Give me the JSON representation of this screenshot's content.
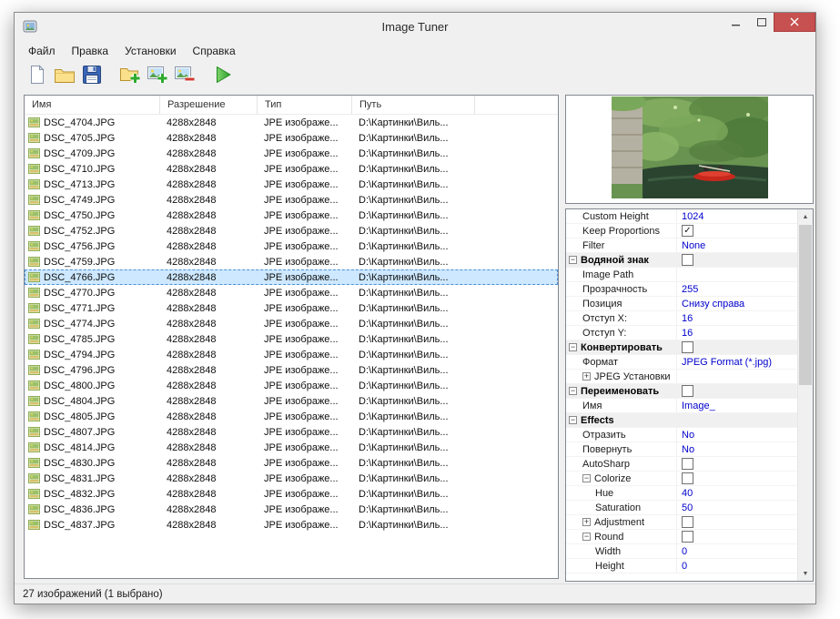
{
  "window": {
    "title": "Image Tuner"
  },
  "menu": {
    "items": [
      {
        "id": "file",
        "label": "Файл"
      },
      {
        "id": "edit",
        "label": "Правка"
      },
      {
        "id": "settings",
        "label": "Установки"
      },
      {
        "id": "help",
        "label": "Справка"
      }
    ]
  },
  "toolbar": {
    "icons": [
      "new-document-icon",
      "open-folder-icon",
      "save-icon",
      "add-folder-icon",
      "add-images-icon",
      "remove-images-icon",
      "run-icon"
    ]
  },
  "file_list": {
    "columns": [
      "Имя",
      "Разрешение",
      "Тип",
      "Путь"
    ],
    "resolution": "4288x2848",
    "type": "JPE изображе...",
    "path": "D:\\Картинки\\Виль...",
    "selected_index": 10,
    "files": [
      "DSC_4704.JPG",
      "DSC_4705.JPG",
      "DSC_4709.JPG",
      "DSC_4710.JPG",
      "DSC_4713.JPG",
      "DSC_4749.JPG",
      "DSC_4750.JPG",
      "DSC_4752.JPG",
      "DSC_4756.JPG",
      "DSC_4759.JPG",
      "DSC_4766.JPG",
      "DSC_4770.JPG",
      "DSC_4771.JPG",
      "DSC_4774.JPG",
      "DSC_4785.JPG",
      "DSC_4794.JPG",
      "DSC_4796.JPG",
      "DSC_4800.JPG",
      "DSC_4804.JPG",
      "DSC_4805.JPG",
      "DSC_4807.JPG",
      "DSC_4814.JPG",
      "DSC_4830.JPG",
      "DSC_4831.JPG",
      "DSC_4832.JPG",
      "DSC_4836.JPG",
      "DSC_4837.JPG"
    ]
  },
  "properties": {
    "rows": [
      {
        "kind": "item",
        "level": 1,
        "label": "Custom Height",
        "value": "1024"
      },
      {
        "kind": "item",
        "level": 1,
        "label": "Keep Proportions",
        "checkbox": true,
        "checked": true
      },
      {
        "kind": "item",
        "level": 1,
        "label": "Filter",
        "value": "None"
      },
      {
        "kind": "section",
        "level": 0,
        "label": "Водяной знак",
        "checkbox": true,
        "checked": false,
        "expander": "minus"
      },
      {
        "kind": "item",
        "level": 1,
        "label": "Image Path",
        "value": ""
      },
      {
        "kind": "item",
        "level": 1,
        "label": "Прозрачность",
        "value": "255"
      },
      {
        "kind": "item",
        "level": 1,
        "label": "Позиция",
        "value": "Снизу справа"
      },
      {
        "kind": "item",
        "level": 1,
        "label": "Отступ X:",
        "value": "16"
      },
      {
        "kind": "item",
        "level": 1,
        "label": "Отступ Y:",
        "value": "16"
      },
      {
        "kind": "section",
        "level": 0,
        "label": "Конвертировать",
        "checkbox": true,
        "checked": false,
        "expander": "minus"
      },
      {
        "kind": "item",
        "level": 1,
        "label": "Формат",
        "value": "JPEG Format (*.jpg)"
      },
      {
        "kind": "item",
        "level": 1,
        "label": "JPEG Установки",
        "expander": "plus"
      },
      {
        "kind": "section",
        "level": 0,
        "label": "Переименовать",
        "checkbox": true,
        "checked": false,
        "expander": "minus"
      },
      {
        "kind": "item",
        "level": 1,
        "label": "Имя",
        "value": "Image_"
      },
      {
        "kind": "section",
        "level": 0,
        "label": "Effects",
        "expander": "minus"
      },
      {
        "kind": "item",
        "level": 1,
        "label": "Отразить",
        "value": "No"
      },
      {
        "kind": "item",
        "level": 1,
        "label": "Повернуть",
        "value": "No"
      },
      {
        "kind": "item",
        "level": 1,
        "label": "AutoSharp",
        "checkbox": true,
        "checked": false
      },
      {
        "kind": "item",
        "level": 1,
        "label": "Colorize",
        "checkbox": true,
        "checked": false,
        "expander": "minus"
      },
      {
        "kind": "item",
        "level": 2,
        "label": "Hue",
        "value": "40"
      },
      {
        "kind": "item",
        "level": 2,
        "label": "Saturation",
        "value": "50"
      },
      {
        "kind": "item",
        "level": 1,
        "label": "Adjustment",
        "checkbox": true,
        "checked": false,
        "expander": "plus"
      },
      {
        "kind": "item",
        "level": 1,
        "label": "Round",
        "checkbox": true,
        "checked": false,
        "expander": "minus"
      },
      {
        "kind": "item",
        "level": 2,
        "label": "Width",
        "value": "0"
      },
      {
        "kind": "item",
        "level": 2,
        "label": "Height",
        "value": "0"
      }
    ]
  },
  "status_bar": {
    "text": "27 изображений (1 выбрано)"
  },
  "colors": {
    "selection_bg": "#cde8ff",
    "value_text": "#0000cd",
    "close_button": "#c75050",
    "section_bg": "#f0f0f0"
  }
}
